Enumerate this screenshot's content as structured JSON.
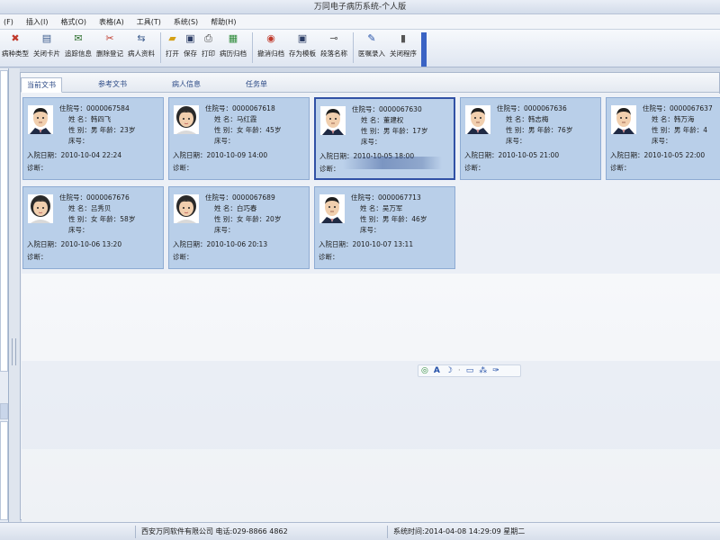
{
  "window": {
    "title": "万同电子病历系统-个人版"
  },
  "menu": [
    {
      "label": "(F)"
    },
    {
      "label": "插入(I)"
    },
    {
      "label": "格式(O)"
    },
    {
      "label": "表格(A)"
    },
    {
      "label": "工具(T)"
    },
    {
      "label": "系统(S)"
    },
    {
      "label": "帮助(H)"
    }
  ],
  "toolbar": {
    "items": [
      {
        "label": "病种类型",
        "icon": "record-type-icon",
        "glyph": "✖",
        "color": "#c0392b"
      },
      {
        "label": "关闭卡片",
        "icon": "close-card-icon",
        "glyph": "▤",
        "color": "#3a5a8c"
      },
      {
        "label": "追踪信息",
        "icon": "trace-info-icon",
        "glyph": "✉",
        "color": "#2c6e2c"
      },
      {
        "label": "删除登记",
        "icon": "delete-register-icon",
        "glyph": "✂",
        "color": "#c0392b"
      },
      {
        "label": "病人资料",
        "icon": "patient-info-icon",
        "glyph": "⇆",
        "color": "#3a5a8c"
      },
      {
        "label": "打开",
        "icon": "open-icon",
        "glyph": "▰",
        "color": "#d4a017"
      },
      {
        "label": "保存",
        "icon": "save-icon",
        "glyph": "▣",
        "color": "#2d3e66"
      },
      {
        "label": "打印",
        "icon": "print-icon",
        "glyph": "⎙",
        "color": "#444444"
      },
      {
        "label": "病历归档",
        "icon": "archive-icon",
        "glyph": "▦",
        "color": "#2e8b3a"
      },
      {
        "label": "撤消归档",
        "icon": "undo-archive-icon",
        "glyph": "◉",
        "color": "#c0392b"
      },
      {
        "label": "存为模板",
        "icon": "save-template-icon",
        "glyph": "▣",
        "color": "#2d3e66"
      },
      {
        "label": "段落名称",
        "icon": "paragraph-name-icon",
        "glyph": "⊸",
        "color": "#555555"
      },
      {
        "label": "医嘱录入",
        "icon": "order-entry-icon",
        "glyph": "✎",
        "color": "#2450a8"
      },
      {
        "label": "关闭程序",
        "icon": "exit-icon",
        "glyph": "▮",
        "color": "#555555"
      }
    ]
  },
  "tabs": [
    {
      "label": "当前文书",
      "active": true
    },
    {
      "label": "参考文书",
      "active": false
    },
    {
      "label": "病人信息",
      "active": false
    },
    {
      "label": "任务单",
      "active": false
    }
  ],
  "labels": {
    "id": "住院号：",
    "name": "姓 名：",
    "gender": "性 别：",
    "age": "年龄：",
    "bed": "床号：",
    "admit": "入院日期：",
    "diagnosis": "诊断："
  },
  "patients": [
    {
      "id": "0000067584",
      "name": "韩四飞",
      "gender": "男",
      "age": "23岁",
      "admit": "2010-10-04 22:24",
      "avatar": "male"
    },
    {
      "id": "0000067618",
      "name": "马红霞",
      "gender": "女",
      "age": "45岁",
      "admit": "2010-10-09 14:00",
      "avatar": "female"
    },
    {
      "id": "0000067630",
      "name": "董建权",
      "gender": "男",
      "age": "17岁",
      "admit": "2010-10-05 18:00",
      "avatar": "male",
      "selected": true
    },
    {
      "id": "0000067636",
      "name": "韩志梅",
      "gender": "男",
      "age": "76岁",
      "admit": "2010-10-05 21:00",
      "avatar": "male"
    },
    {
      "id": "0000067637",
      "name": "韩万海",
      "gender": "男",
      "age": "4",
      "admit": "2010-10-05 22:00",
      "avatar": "male"
    },
    {
      "id": "0000067676",
      "name": "吕秀贝",
      "gender": "女",
      "age": "58岁",
      "admit": "2010-10-06 13:20",
      "avatar": "female"
    },
    {
      "id": "0000067689",
      "name": "白巧春",
      "gender": "女",
      "age": "20岁",
      "admit": "2010-10-06 20:13",
      "avatar": "female"
    },
    {
      "id": "0000067713",
      "name": "吴万军",
      "gender": "男",
      "age": "46岁",
      "admit": "2010-10-07 13:11",
      "avatar": "male"
    }
  ],
  "status": {
    "company": "西安万同软件有限公司  电话:029-8866 4862",
    "time": "系统时间:2014-04-08 14:29:09 星期二"
  }
}
